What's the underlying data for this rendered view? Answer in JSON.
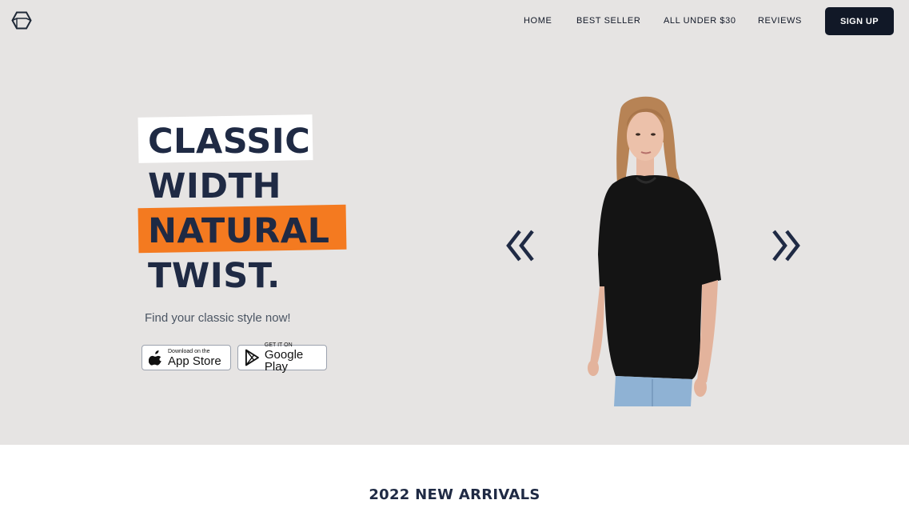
{
  "header": {
    "logo_icon": "hexagon-cube-icon",
    "nav": [
      {
        "label": "HOME"
      },
      {
        "label": "BEST SELLER"
      },
      {
        "label": "ALL UNDER $30"
      },
      {
        "label": "REVIEWS"
      }
    ],
    "signup_label": "SIGN UP"
  },
  "hero": {
    "headline": [
      "CLASSIC",
      "WIDTH",
      "NATURAL",
      "TWIST."
    ],
    "tagline": "Find your classic style now!",
    "app_store": {
      "small": "Download on the",
      "big": "App Store",
      "icon": "apple-icon"
    },
    "google_play": {
      "small": "GET IT ON",
      "big": "Google Play",
      "icon": "google-play-icon"
    },
    "prev_icon": "double-chevron-left-icon",
    "next_icon": "double-chevron-right-icon"
  },
  "section": {
    "title": "2022 NEW ARRIVALS"
  },
  "colors": {
    "hero_bg": "#e6e4e3",
    "accent": "#f47a20",
    "navy": "#1f2a44",
    "button_dark": "#111827"
  }
}
